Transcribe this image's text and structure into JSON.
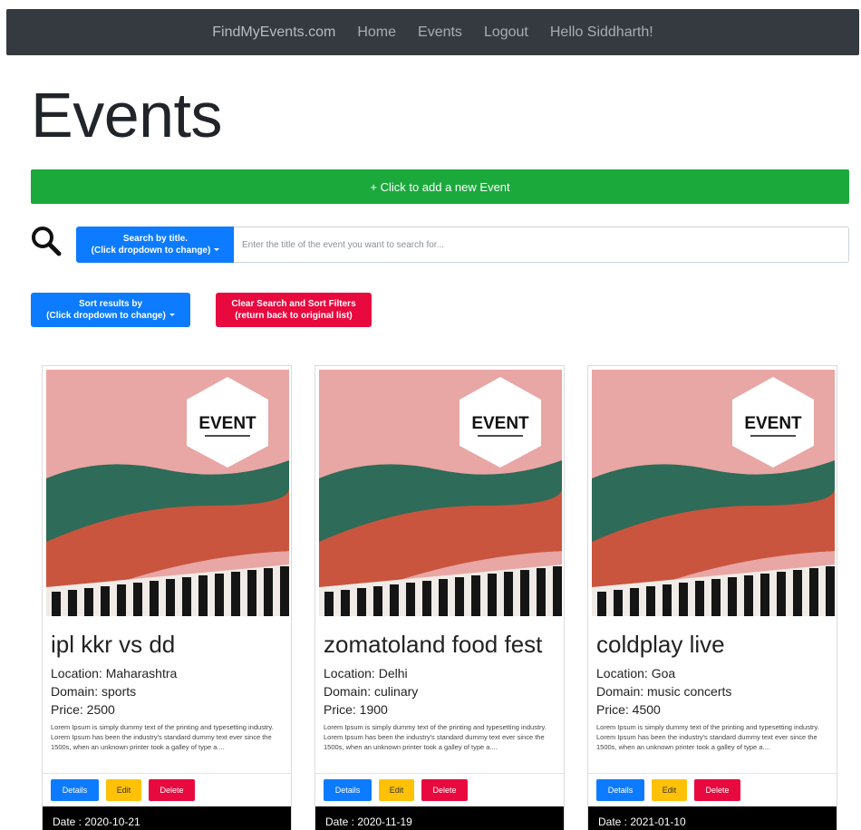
{
  "nav": {
    "brand": "FindMyEvents.com",
    "links": [
      "Home",
      "Events",
      "Logout"
    ],
    "greeting": "Hello Siddharth!"
  },
  "page_title": "Events",
  "add_event_label": "+ Click to add a new Event",
  "search": {
    "dropdown_line1": "Search by title.",
    "dropdown_line2": "(Click dropdown to change)",
    "placeholder": "Enter the title of the event you want to search for..."
  },
  "sort": {
    "line1": "Sort results by",
    "line2": "(Click dropdown to change)"
  },
  "clear": {
    "line1": "Clear Search and Sort Filters",
    "line2": "(return back to original list)"
  },
  "card_image_text": "EVENT",
  "cards": [
    {
      "title": "ipl kkr vs dd",
      "location": "Location: Maharashtra",
      "domain": "Domain: sports",
      "price": "Price: 2500",
      "description": "Lorem Ipsum is simply dummy text of the printing and typesetting industry. Lorem Ipsum has been the industry's standard dummy text ever since the 1500s, when an unknown printer took a galley of type a....",
      "details_label": "Details",
      "edit_label": "Edit",
      "delete_label": "Delete",
      "date": "Date : 2020-10-21"
    },
    {
      "title": "zomatoland food fest",
      "location": "Location: Delhi",
      "domain": "Domain: culinary",
      "price": "Price: 1900",
      "description": "Lorem Ipsum is simply dummy text of the printing and typesetting industry. Lorem Ipsum has been the industry's standard dummy text ever since the 1500s, when an unknown printer took a galley of type a....",
      "details_label": "Details",
      "edit_label": "Edit",
      "delete_label": "Delete",
      "date": "Date : 2020-11-19"
    },
    {
      "title": "coldplay live",
      "location": "Location: Goa",
      "domain": "Domain: music concerts",
      "price": "Price: 4500",
      "description": "Lorem Ipsum is simply dummy text of the printing and typesetting industry. Lorem Ipsum has been the industry's standard dummy text ever since the 1500s, when an unknown printer took a galley of type a....",
      "details_label": "Details",
      "edit_label": "Edit",
      "delete_label": "Delete",
      "date": "Date : 2021-01-10"
    }
  ],
  "colors": {
    "navbar": "#343a40",
    "success": "#1ca93c",
    "primary": "#0d7bff",
    "danger": "#e8093e",
    "warning": "#ffc107",
    "image_pink": "#e8a6a4",
    "image_green": "#2e6b58",
    "image_red": "#c9553e"
  }
}
